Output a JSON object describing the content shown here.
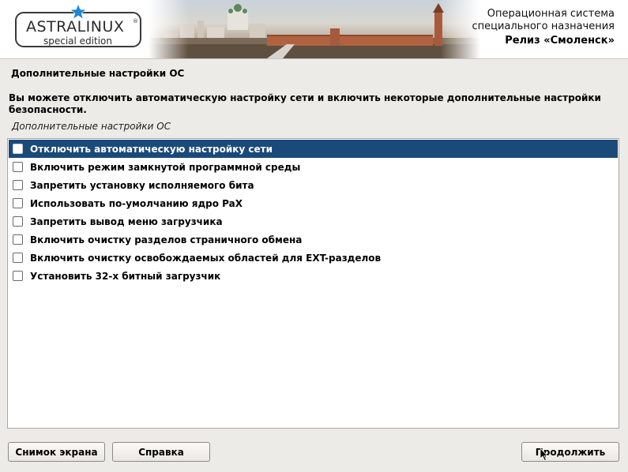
{
  "banner": {
    "logo_title": "ASTRALINUX",
    "logo_registered": "®",
    "logo_subtitle": "special edition",
    "os_line1": "Операционная система",
    "os_line2": "специального назначения",
    "release": "Релиз «Смоленск»"
  },
  "page": {
    "title": "Дополнительные настройки ОС",
    "description": "Вы можете отключить автоматическую настройку сети и включить некоторые дополнительные настройки безопасности.",
    "list_caption": "Дополнительные настройки ОС"
  },
  "options": [
    {
      "label": "Отключить автоматическую настройку сети",
      "checked": false,
      "selected": true
    },
    {
      "label": "Включить режим замкнутой программной среды",
      "checked": false,
      "selected": false
    },
    {
      "label": "Запретить установку исполняемого бита",
      "checked": false,
      "selected": false
    },
    {
      "label": "Использовать по-умолчанию ядро PaX",
      "checked": false,
      "selected": false
    },
    {
      "label": "Запретить вывод меню загрузчика",
      "checked": false,
      "selected": false
    },
    {
      "label": "Включить очистку разделов страничного обмена",
      "checked": false,
      "selected": false
    },
    {
      "label": "Включить очистку освобождаемых областей для EXT-разделов",
      "checked": false,
      "selected": false
    },
    {
      "label": "Установить 32-х битный загрузчик",
      "checked": false,
      "selected": false
    }
  ],
  "buttons": {
    "screenshot": "Снимок экрана",
    "help": "Справка",
    "continue": "Продолжить"
  },
  "colors": {
    "selection": "#1a4a7a",
    "background": "#edebe7",
    "star": "#1f86d3"
  },
  "icons": {
    "logo_star": "star-icon",
    "checkbox": "checkbox-icon",
    "cursor": "mouse-pointer-icon"
  }
}
